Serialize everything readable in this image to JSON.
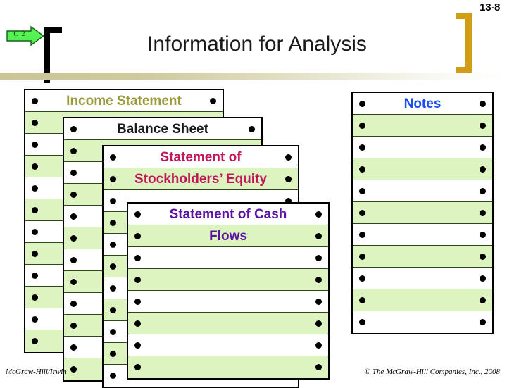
{
  "header": {
    "slide_number": "13-8",
    "chapter_badge": "C 2",
    "title": "Information for Analysis"
  },
  "colors": {
    "row_green": "#ddf4c0",
    "income_statement": "#9a9a3b",
    "balance_sheet": "#1a1a1a",
    "stockholders_equity": "#c2185b",
    "cash_flows": "#5b12a5",
    "notes": "#1b4ef0",
    "bracket_gold": "#D29C14",
    "divider_khaki": "#c9c596"
  },
  "documents": [
    {
      "id": "income",
      "name": "income-statement",
      "rows": 12,
      "heading_rows": [
        {
          "index": 0,
          "text": "Income Statement"
        }
      ]
    },
    {
      "id": "balance",
      "name": "balance-sheet",
      "rows": 12,
      "heading_rows": [
        {
          "index": 0,
          "text": "Balance Sheet"
        }
      ]
    },
    {
      "id": "equity",
      "name": "statement-of-stockholders-equity",
      "rows": 11,
      "heading_rows": [
        {
          "index": 0,
          "text": "Statement of"
        },
        {
          "index": 1,
          "text": "Stockholders’ Equity"
        }
      ]
    },
    {
      "id": "cashflow",
      "name": "statement-of-cash-flows",
      "rows": 8,
      "heading_rows": [
        {
          "index": 0,
          "text": "Statement of Cash"
        },
        {
          "index": 1,
          "text": "Flows"
        }
      ]
    },
    {
      "id": "notes",
      "name": "notes",
      "rows": 11,
      "heading_rows": [
        {
          "index": 0,
          "text": "Notes"
        }
      ]
    }
  ],
  "footer": {
    "left": "McGraw-Hill/Irwin",
    "right": "© The McGraw-Hill Companies, Inc., 2008"
  }
}
